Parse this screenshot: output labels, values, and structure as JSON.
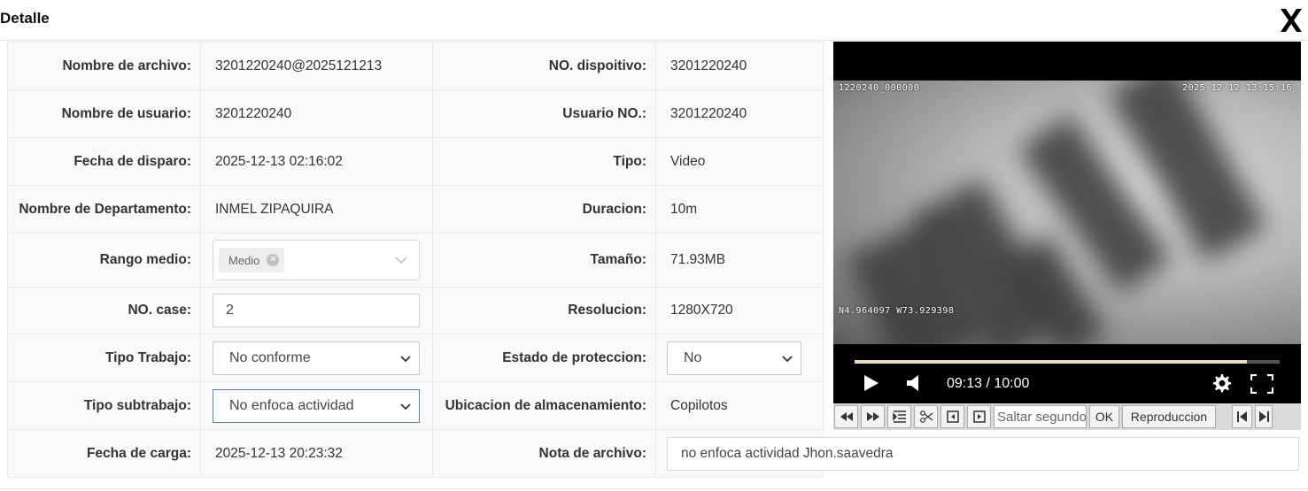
{
  "dialog": {
    "title": "Detalle",
    "close_icon": "close-icon"
  },
  "fields": {
    "file_name_label": "Nombre de archivo:",
    "file_name": "3201220240@2025121213",
    "device_no_label": "NO. dispoitivo:",
    "device_no": "3201220240",
    "user_name_label": "Nombre de usuario:",
    "user_name": "3201220240",
    "user_no_label": "Usuario NO.:",
    "user_no": "3201220240",
    "shot_date_label": "Fecha de disparo:",
    "shot_date": "2025-12-13 02:16:02",
    "type_label": "Tipo:",
    "type": "Video",
    "department_label": "Nombre de Departamento:",
    "department": "INMEL ZIPAQUIRA",
    "duration_label": "Duracion:",
    "duration": "10m",
    "media_range_label": "Rango medio:",
    "media_range_tag": "Medio",
    "size_label": "Tamaño:",
    "size": "71.93MB",
    "case_no_label": "NO. case:",
    "case_no": "2",
    "resolution_label": "Resolucion:",
    "resolution": "1280X720",
    "work_type_label": "Tipo Trabajo:",
    "work_type": "No conforme",
    "protection_label": "Estado de proteccion:",
    "protection": "No",
    "subwork_type_label": "Tipo subtrabajo:",
    "subwork_type": "No enfoca actividad",
    "storage_label": "Ubicacion de almacenamiento:",
    "storage": "Copilotos",
    "upload_date_label": "Fecha de carga:",
    "upload_date": "2025-12-13 20:23:32",
    "file_note_label": "Nota de archivo:",
    "file_note": "no enfoca actividad Jhon.saavedra"
  },
  "video": {
    "osd_top_left": "1220240_000000",
    "osd_top_right": "2025-12-12  13:15:16",
    "osd_gps": "N4.964097  W73.929398",
    "time_display": "09:13 / 10:00",
    "progress": 0.922
  },
  "toolbar": {
    "seek_placeholder": "Saltar segundos",
    "ok_label": "OK",
    "playback_label": "Reproduccion"
  }
}
